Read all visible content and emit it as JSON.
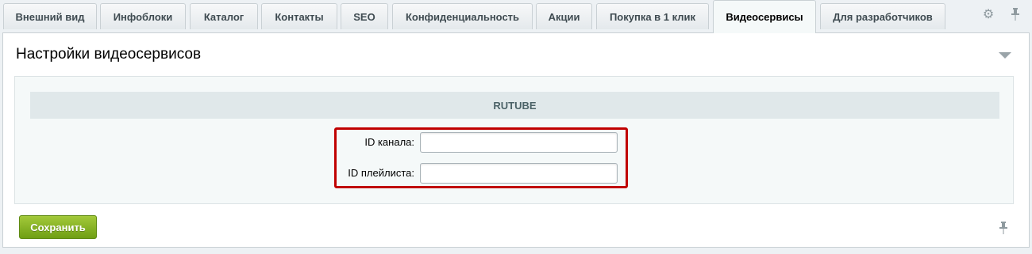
{
  "tabs": [
    {
      "label": "Внешний вид"
    },
    {
      "label": "Инфоблоки"
    },
    {
      "label": "Каталог"
    },
    {
      "label": "Контакты"
    },
    {
      "label": "SEO"
    },
    {
      "label": "Конфиденциальность"
    },
    {
      "label": "Акции"
    },
    {
      "label": "Покупка в 1 клик"
    },
    {
      "label": "Видеосервисы"
    },
    {
      "label": "Для разработчиков"
    }
  ],
  "active_tab": "Видеосервисы",
  "panel": {
    "title": "Настройки видеосервисов",
    "section_title": "RUTUBE",
    "fields": [
      {
        "label": "ID канала:",
        "value": ""
      },
      {
        "label": "ID плейлиста:",
        "value": ""
      }
    ]
  },
  "actions": {
    "save_label": "Сохранить"
  },
  "icons": {
    "settings": "gear-icon",
    "pin": "pin-icon",
    "collapse": "chevron-down-icon"
  },
  "colors": {
    "highlight": "#c00000",
    "save_button": "#7aa81b"
  }
}
